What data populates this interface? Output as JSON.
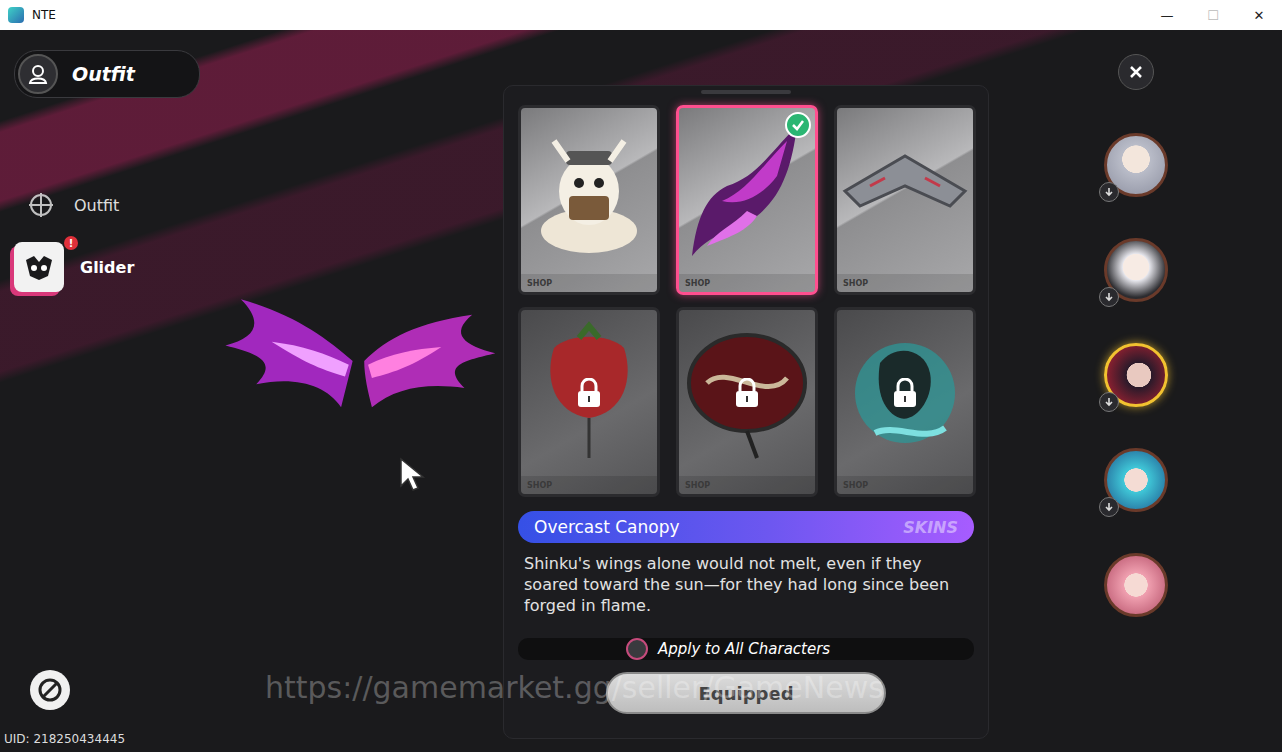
{
  "window": {
    "title": "NTE",
    "controls": [
      "—",
      "☐",
      "✕"
    ]
  },
  "header": {
    "title": "Outfit"
  },
  "sidebar": {
    "items": [
      {
        "label": "Outfit",
        "selected": false,
        "badge": ""
      },
      {
        "label": "Glider",
        "selected": true,
        "badge": "!"
      }
    ]
  },
  "uid": "UID: 218250434445",
  "items": [
    {
      "tag": "SHOP",
      "selected": false,
      "locked": false
    },
    {
      "tag": "SHOP",
      "selected": true,
      "locked": false
    },
    {
      "tag": "SHOP",
      "selected": false,
      "locked": false
    },
    {
      "tag": "SHOP",
      "selected": false,
      "locked": true
    },
    {
      "tag": "SHOP",
      "selected": false,
      "locked": true
    },
    {
      "tag": "SHOP",
      "selected": false,
      "locked": true
    }
  ],
  "detail": {
    "name": "Overcast Canopy",
    "category": "SKINS",
    "description": "Shinku's wings alone would not melt, even if they soared toward the sun—for they had long since been forged in flame."
  },
  "apply_all": {
    "label": "Apply to All Characters",
    "on": false
  },
  "action": {
    "label": "Equipped",
    "disabled": true
  },
  "characters": [
    {
      "selected": false,
      "download": true
    },
    {
      "selected": false,
      "download": true
    },
    {
      "selected": true,
      "download": true
    },
    {
      "selected": false,
      "download": true
    },
    {
      "selected": false,
      "download": false
    }
  ],
  "watermark": "https://gamemarket.gg/seller/GameNews"
}
